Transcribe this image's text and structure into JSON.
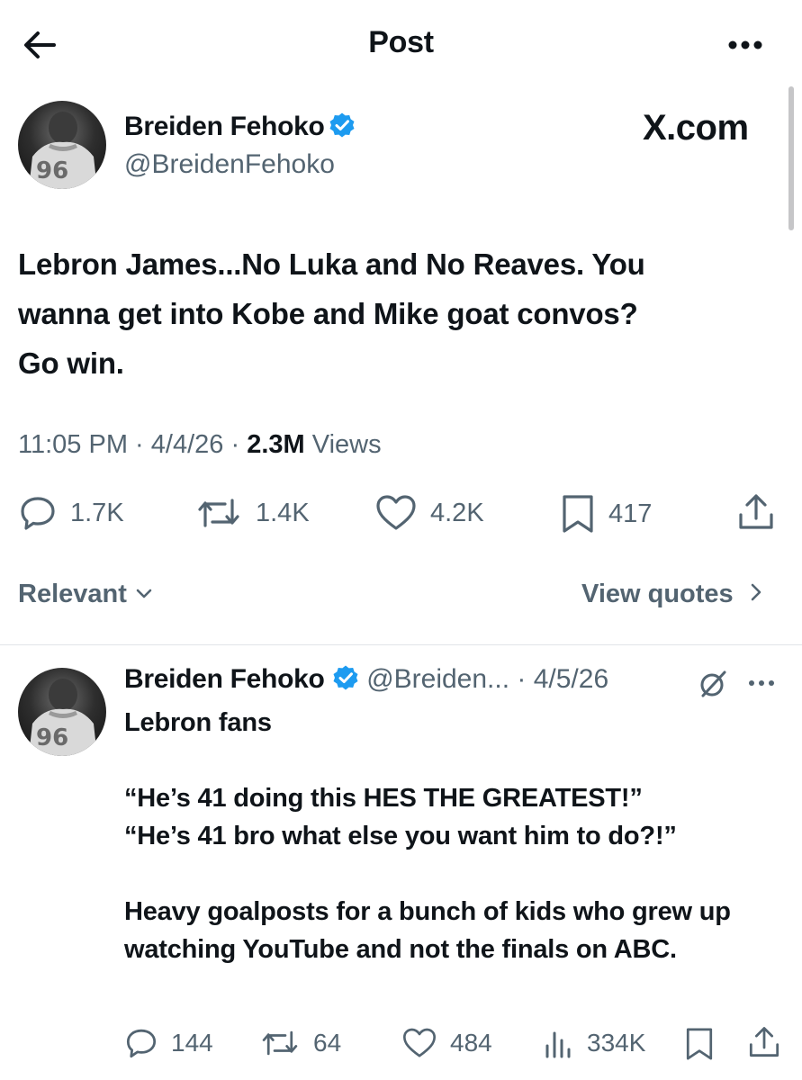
{
  "header": {
    "title": "Post",
    "back_icon": "arrow-left-icon",
    "more_icon": "more-horizontal-icon"
  },
  "post": {
    "author_name": "Breiden Fehoko",
    "handle": "@BreidenFehoko",
    "jersey_number": "96",
    "watermark": "X.com",
    "text_lines": [
      "Lebron James...No Luka and No Reaves. You",
      "wanna get into Kobe and Mike goat convos?",
      "Go win."
    ],
    "time": "11:05 PM",
    "date": "4/4/26",
    "views_count": "2.3M",
    "views_label": "Views",
    "separator": "·",
    "stats": {
      "replies": "1.7K",
      "reposts": "1.4K",
      "likes": "4.2K",
      "bookmarks": "417"
    }
  },
  "sort": {
    "label": "Relevant",
    "quotes_label": "View quotes"
  },
  "reply": {
    "author_name": "Breiden Fehoko",
    "handle": "@Breiden...",
    "date": "· 4/5/26",
    "jersey_number": "96",
    "paragraphs": [
      "Lebron fans",
      "“He’s 41 doing this HES THE GREATEST!”\n“He’s 41 bro what else you want him to do?!”",
      "Heavy goalposts for a bunch of kids who grew up watching YouTube and not the finals on ABC."
    ],
    "stats": {
      "replies": "144",
      "reposts": "64",
      "likes": "484",
      "views": "334K"
    }
  },
  "colors": {
    "text": "#0f1419",
    "muted": "#536471",
    "verified": "#1d9bf0",
    "divider": "#e1e4e8"
  }
}
